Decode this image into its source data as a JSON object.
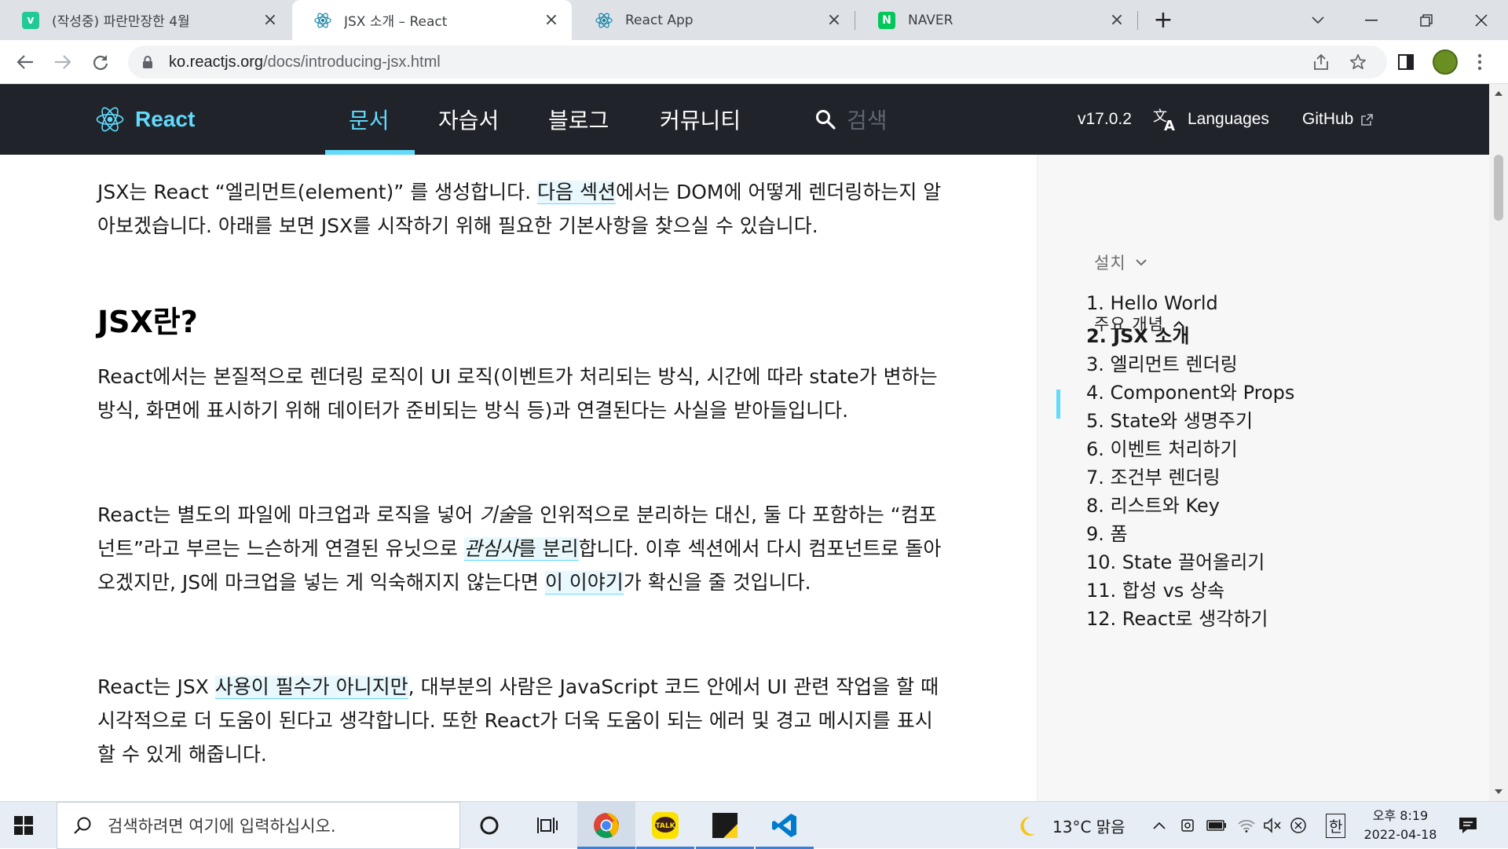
{
  "browser": {
    "tabs": [
      {
        "title": "(작성중) 파란만장한 4월",
        "favicon": "velog-icon",
        "favicon_color": "#20c997",
        "favicon_letter": "v"
      },
      {
        "title": "JSX 소개 – React",
        "favicon": "react-icon",
        "active": true
      },
      {
        "title": "React App",
        "favicon": "react-icon"
      },
      {
        "title": "NAVER",
        "favicon": "naver-icon",
        "favicon_color": "#03c75a",
        "favicon_letter": "N"
      }
    ],
    "url_host": "ko.reactjs.org",
    "url_path": "/docs/introducing-jsx.html"
  },
  "site": {
    "brand": "React",
    "nav": [
      "문서",
      "자습서",
      "블로그",
      "커뮤니티"
    ],
    "search_placeholder": "검색",
    "version": "v17.0.2",
    "languages": "Languages",
    "github": "GitHub",
    "accent": "#61dafb",
    "nav_bg": "#20232a"
  },
  "article": {
    "intro_a": "JSX는 React “엘리먼트(element)” 를 생성합니다. ",
    "intro_link": "다음 섹션",
    "intro_b": "에서는 DOM에 어떻게 렌더링하는지 알아보겠습니다. 아래를 보면 JSX를 시작하기 위해 필요한 기본사항을 찾으실 수 있습니다.",
    "heading": "JSX란?",
    "p1": "React에서는 본질적으로 렌더링 로직이 UI 로직(이벤트가 처리되는 방식, 시간에 따라 state가 변하는 방식, 화면에 표시하기 위해 데이터가 준비되는 방식 등)과 연결된다는 사실을 받아들입니다.",
    "p2_a": "React는 별도의 파일에 마크업과 로직을 넣어 ",
    "p2_em": "기술",
    "p2_b": "을 인위적으로 분리하는 대신, 둘 다 포함하는 “컴포넌트”라고 부르는 느슨하게 연결된 유닛으로 ",
    "p2_link1_em": "관심사",
    "p2_link1_rest": "를 분리",
    "p2_c": "합니다. 이후 섹션에서 다시 컴포넌트로 돌아오겠지만, JS에 마크업을 넣는 게 익숙해지지 않는다면 ",
    "p2_link2": "이 이야기",
    "p2_d": "가 확신을 줄 것입니다.",
    "p3_a": "React는 JSX ",
    "p3_link": "사용이 필수가 아니지만",
    "p3_b": ", 대부분의 사람은 JavaScript 코드 안에서 UI 관련 작업을 할 때 시각적으로 더 도움이 된다고 생각합니다. 또한 React가 더욱 도움이 되는 에러 및 경고 메시지를 표시할 수 있게 해줍니다."
  },
  "sidebar": {
    "section_install": "설치",
    "section_main": "주요 개념",
    "items": [
      "1. Hello World",
      "2. JSX 소개",
      "3. 엘리먼트 렌더링",
      "4. Component와 Props",
      "5. State와 생명주기",
      "6. 이벤트 처리하기",
      "7. 조건부 렌더링",
      "8. 리스트와 Key",
      "9. 폼",
      "10. State 끌어올리기",
      "11. 합성 vs 상속",
      "12. React로 생각하기"
    ],
    "current_index": 1
  },
  "taskbar": {
    "search_placeholder": "검색하려면 여기에 입력하십시오.",
    "weather": "13°C  맑음",
    "ime": "한",
    "time": "오후 8:19",
    "date": "2022-04-18"
  }
}
